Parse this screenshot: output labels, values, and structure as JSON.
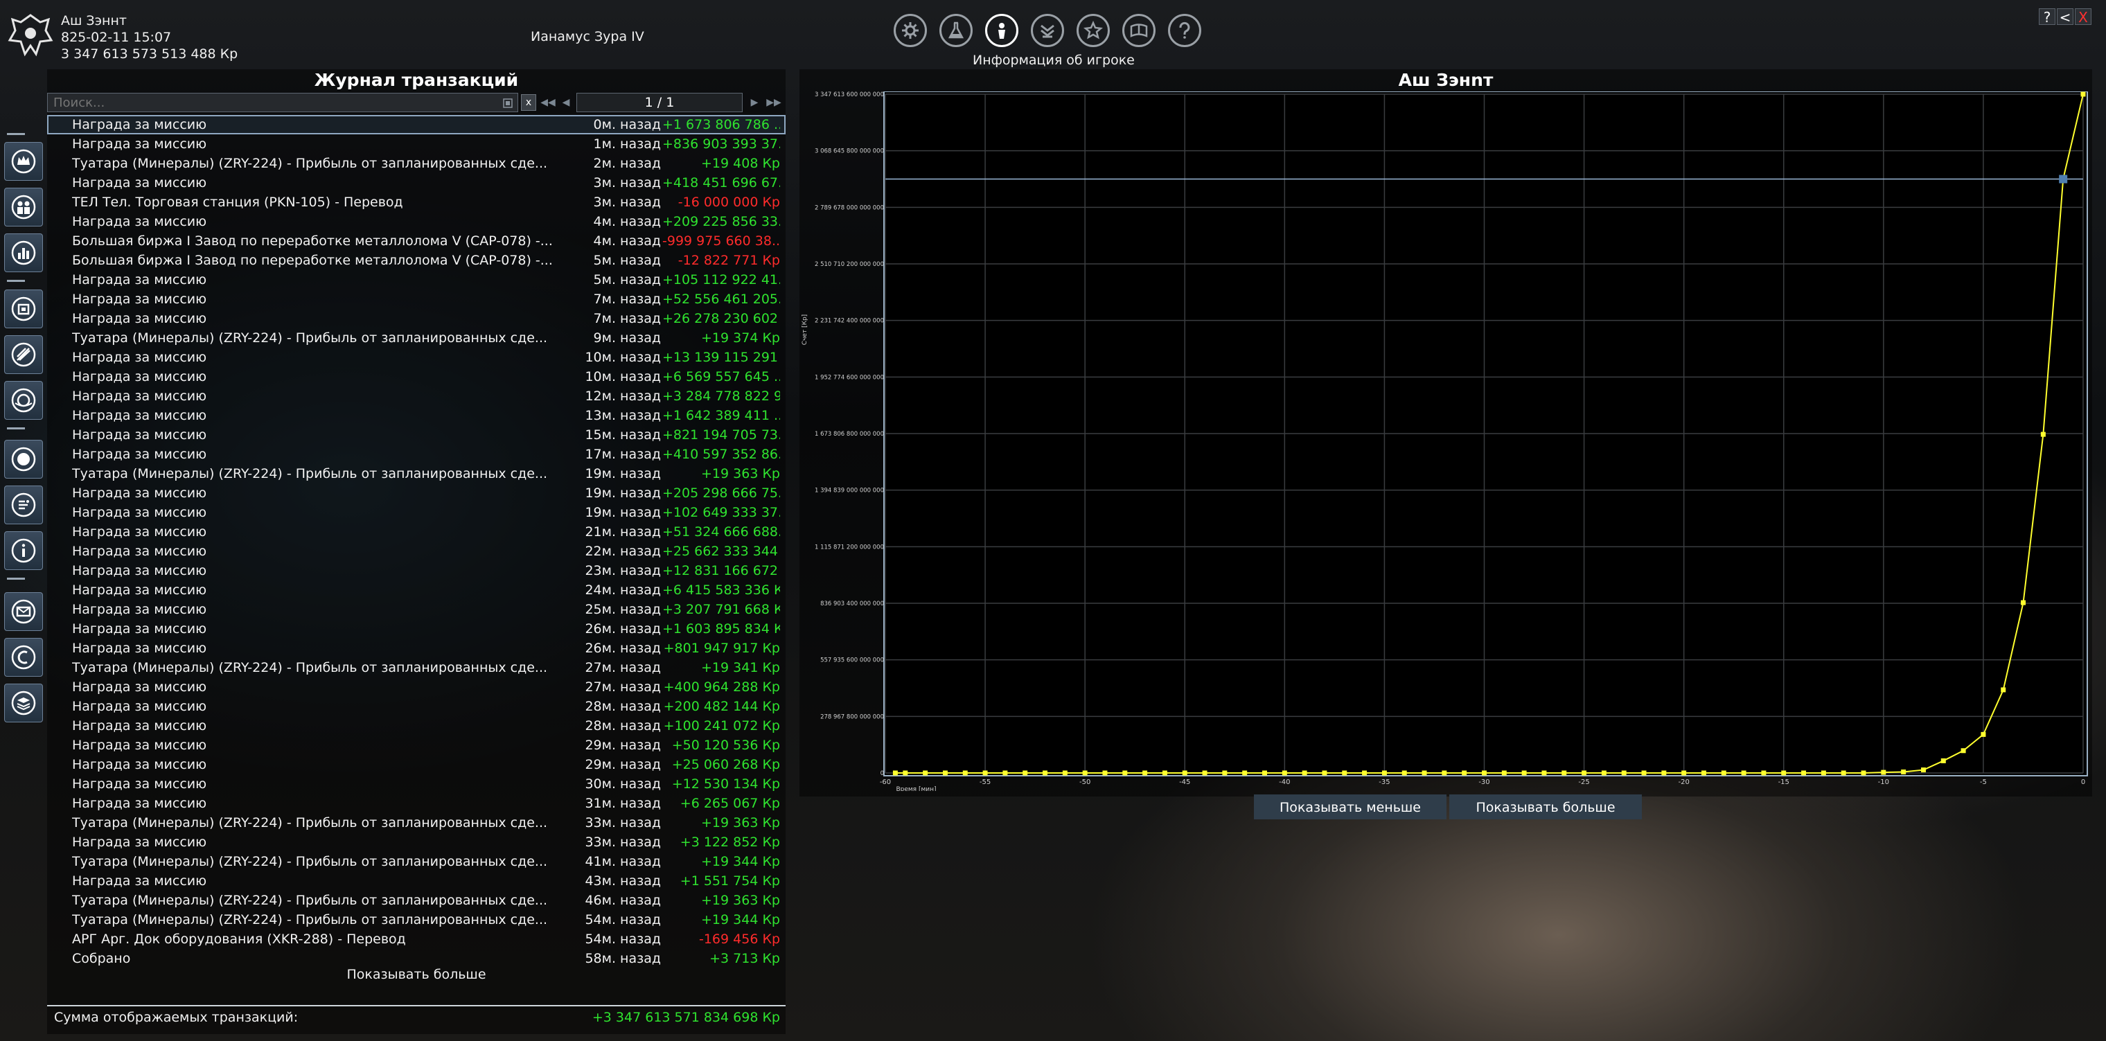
{
  "header": {
    "player_name": "Аш Зэннт",
    "datetime": "825-02-11 15:07",
    "balance": "3 347 613 573 513 488 Кр",
    "sector": "Ианамус Зура IV"
  },
  "menu": {
    "icons": [
      "settings-icon",
      "flask-icon",
      "player-info-icon",
      "ship-icon",
      "empire-icon",
      "encyclopedia-icon",
      "help-icon"
    ],
    "active_label": "Информация об игроке"
  },
  "window_controls": [
    "?",
    "<",
    "X"
  ],
  "rail_icons": [
    "crown-icon",
    "people-icon",
    "bar-chart-icon",
    "station-icon",
    "ship-gear-icon",
    "globe-icon",
    "planet-icon",
    "fleet-icon",
    "info-icon",
    "mail-icon",
    "credits-icon",
    "stack-icon"
  ],
  "transactions": {
    "title": "Журнал транзакций",
    "search_placeholder": "Поиск...",
    "clear": "x",
    "page": "1 / 1",
    "rows": [
      {
        "desc": "Награда за миссию",
        "time": "0м. назад",
        "amount": "+1 673 806 786 ...",
        "sign": "pos"
      },
      {
        "desc": "Награда за миссию",
        "time": "1м. назад",
        "amount": "+836 903 393 37...",
        "sign": "pos"
      },
      {
        "desc": "Туатара (Минералы) (ZRY-224) - Прибыль от запланированных сде...",
        "time": "2м. назад",
        "amount": "+19 408 Кр",
        "sign": "pos"
      },
      {
        "desc": "Награда за миссию",
        "time": "3м. назад",
        "amount": "+418 451 696 67...",
        "sign": "pos"
      },
      {
        "desc": "ТЕЛ Тел. Торговая станция (PKN-105) - Перевод",
        "time": "3м. назад",
        "amount": "-16 000 000 Кр",
        "sign": "neg"
      },
      {
        "desc": "Награда за миссию",
        "time": "4м. назад",
        "amount": "+209 225 856 33...",
        "sign": "pos"
      },
      {
        "desc": "Большая биржа I Завод по переработке металлолома V (CAP-078) -...",
        "time": "4м. назад",
        "amount": "-999 975 660 38...",
        "sign": "neg"
      },
      {
        "desc": "Большая биржа I Завод по переработке металлолома V (CAP-078) -...",
        "time": "5м. назад",
        "amount": "-12 822 771 Кр",
        "sign": "neg"
      },
      {
        "desc": "Награда за миссию",
        "time": "5м. назад",
        "amount": "+105 112 922 41...",
        "sign": "pos"
      },
      {
        "desc": "Награда за миссию",
        "time": "7м. назад",
        "amount": "+52 556 461 205...",
        "sign": "pos"
      },
      {
        "desc": "Награда за миссию",
        "time": "7м. назад",
        "amount": "+26 278 230 602 ...",
        "sign": "pos"
      },
      {
        "desc": "Туатара (Минералы) (ZRY-224) - Прибыль от запланированных сде...",
        "time": "9м. назад",
        "amount": "+19 374 Кр",
        "sign": "pos"
      },
      {
        "desc": "Награда за миссию",
        "time": "10м. назад",
        "amount": "+13 139 115 291 ...",
        "sign": "pos"
      },
      {
        "desc": "Награда за миссию",
        "time": "10м. назад",
        "amount": "+6 569 557 645 ...",
        "sign": "pos"
      },
      {
        "desc": "Награда за миссию",
        "time": "12м. назад",
        "amount": "+3 284 778 822 9...",
        "sign": "pos"
      },
      {
        "desc": "Награда за миссию",
        "time": "13м. назад",
        "amount": "+1 642 389 411 ...",
        "sign": "pos"
      },
      {
        "desc": "Награда за миссию",
        "time": "15м. назад",
        "amount": "+821 194 705 73...",
        "sign": "pos"
      },
      {
        "desc": "Награда за миссию",
        "time": "17м. назад",
        "amount": "+410 597 352 86...",
        "sign": "pos"
      },
      {
        "desc": "Туатара (Минералы) (ZRY-224) - Прибыль от запланированных сде...",
        "time": "19м. назад",
        "amount": "+19 363 Кр",
        "sign": "pos"
      },
      {
        "desc": "Награда за миссию",
        "time": "19м. назад",
        "amount": "+205 298 666 75...",
        "sign": "pos"
      },
      {
        "desc": "Награда за миссию",
        "time": "19м. назад",
        "amount": "+102 649 333 37...",
        "sign": "pos"
      },
      {
        "desc": "Награда за миссию",
        "time": "21м. назад",
        "amount": "+51 324 666 688...",
        "sign": "pos"
      },
      {
        "desc": "Награда за миссию",
        "time": "22м. назад",
        "amount": "+25 662 333 344 ...",
        "sign": "pos"
      },
      {
        "desc": "Награда за миссию",
        "time": "23м. назад",
        "amount": "+12 831 166 672 ...",
        "sign": "pos"
      },
      {
        "desc": "Награда за миссию",
        "time": "24м. назад",
        "amount": "+6 415 583 336 Кр",
        "sign": "pos"
      },
      {
        "desc": "Награда за миссию",
        "time": "25м. назад",
        "amount": "+3 207 791 668 Кр",
        "sign": "pos"
      },
      {
        "desc": "Награда за миссию",
        "time": "26м. назад",
        "amount": "+1 603 895 834 Кр",
        "sign": "pos"
      },
      {
        "desc": "Награда за миссию",
        "time": "26м. назад",
        "amount": "+801 947 917 Кр",
        "sign": "pos"
      },
      {
        "desc": "Туатара (Минералы) (ZRY-224) - Прибыль от запланированных сде...",
        "time": "27м. назад",
        "amount": "+19 341 Кр",
        "sign": "pos"
      },
      {
        "desc": "Награда за миссию",
        "time": "27м. назад",
        "amount": "+400 964 288 Кр",
        "sign": "pos"
      },
      {
        "desc": "Награда за миссию",
        "time": "28м. назад",
        "amount": "+200 482 144 Кр",
        "sign": "pos"
      },
      {
        "desc": "Награда за миссию",
        "time": "28м. назад",
        "amount": "+100 241 072 Кр",
        "sign": "pos"
      },
      {
        "desc": "Награда за миссию",
        "time": "29м. назад",
        "amount": "+50 120 536 Кр",
        "sign": "pos"
      },
      {
        "desc": "Награда за миссию",
        "time": "29м. назад",
        "amount": "+25 060 268 Кр",
        "sign": "pos"
      },
      {
        "desc": "Награда за миссию",
        "time": "30м. назад",
        "amount": "+12 530 134 Кр",
        "sign": "pos"
      },
      {
        "desc": "Награда за миссию",
        "time": "31м. назад",
        "amount": "+6 265 067 Кр",
        "sign": "pos"
      },
      {
        "desc": "Туатара (Минералы) (ZRY-224) - Прибыль от запланированных сде...",
        "time": "33м. назад",
        "amount": "+19 363 Кр",
        "sign": "pos"
      },
      {
        "desc": "Награда за миссию",
        "time": "33м. назад",
        "amount": "+3 122 852 Кр",
        "sign": "pos"
      },
      {
        "desc": "Туатара (Минералы) (ZRY-224) - Прибыль от запланированных сде...",
        "time": "41м. назад",
        "amount": "+19 344 Кр",
        "sign": "pos"
      },
      {
        "desc": "Награда за миссию",
        "time": "43м. назад",
        "amount": "+1 551 754 Кр",
        "sign": "pos"
      },
      {
        "desc": "Туатара (Минералы) (ZRY-224) - Прибыль от запланированных сде...",
        "time": "46м. назад",
        "amount": "+19 363 Кр",
        "sign": "pos"
      },
      {
        "desc": "Туатара (Минералы) (ZRY-224) - Прибыль от запланированных сде...",
        "time": "54м. назад",
        "amount": "+19 344 Кр",
        "sign": "pos"
      },
      {
        "desc": "АРГ Арг. Док оборудования (XKR-288) - Перевод",
        "time": "54м. назад",
        "amount": "-169 456 Кр",
        "sign": "neg"
      },
      {
        "desc": "Собрано",
        "time": "58м. назад",
        "amount": "+3 713 Кр",
        "sign": "pos"
      }
    ],
    "show_more": "Показывать больше",
    "sum_label": "Сумма отображаемых транзакций:",
    "sum_value": "+3 347 613 571 834 698 Кр"
  },
  "chart_panel": {
    "show_less": "Показывать меньше",
    "show_more": "Показывать больше"
  },
  "chart_data": {
    "type": "line",
    "title": "Аш Зэнnт",
    "xlabel": "Время [мин]",
    "ylabel": "Счет [Кр]",
    "xlim": [
      -60,
      0
    ],
    "ylim": [
      0,
      3347613600000000
    ],
    "x_ticks": [
      "-60",
      "-55",
      "-50",
      "-45",
      "-40",
      "-35",
      "-30",
      "-25",
      "-20",
      "-15",
      "-10",
      "-5",
      "0"
    ],
    "y_ticks": [
      "0",
      "278 967 800 000 000",
      "557 935 600 000 000",
      "836 903 400 000 000",
      "1 115 871 200 000 000",
      "1 394 839 000 000 000",
      "1 673 806 800 000 000",
      "1 952 774 600 000 000",
      "2 231 742 400 000 000",
      "2 510 710 200 000 000",
      "2 789 678 000 000 000",
      "3 068 645 800 000 000",
      "3 347 613 600 000 000"
    ],
    "grid": true,
    "line_color": "#ffff2e",
    "marker_value": 2929000000000000,
    "series": [
      {
        "x": [
          -59.5,
          -59,
          -58,
          -57,
          -56,
          -55,
          -54,
          -53,
          -52,
          -51,
          -50,
          -49,
          -48,
          -47,
          -46,
          -45,
          -44,
          -43,
          -42,
          -41,
          -40,
          -39,
          -38,
          -37,
          -36,
          -35,
          -34,
          -33,
          -32,
          -31,
          -30,
          -29,
          -28,
          -27,
          -26,
          -25,
          -24,
          -23,
          -22,
          -21,
          -20,
          -19,
          -18,
          -17,
          -16,
          -15,
          -14,
          -13,
          -12,
          -11,
          -10,
          -9,
          -8,
          -7,
          -6,
          -5,
          -4,
          -3,
          -2,
          -1,
          0
        ],
        "y": [
          0,
          0,
          0,
          0,
          0,
          0,
          0,
          0,
          0,
          0,
          0,
          0,
          0,
          0,
          0,
          0,
          0,
          0,
          0,
          0,
          0,
          0,
          0,
          0,
          0,
          0,
          0,
          0,
          0,
          0,
          0,
          0,
          0,
          0,
          0,
          0,
          0,
          0,
          0,
          0,
          0,
          0,
          0,
          0,
          0,
          0,
          0,
          0,
          0,
          0,
          3000000000000,
          5000000000000,
          15000000000000,
          60000000000000,
          110000000000000,
          190000000000000,
          410000000000000,
          840000000000000,
          1670000000000000,
          2930000000000000,
          3347613571834698
        ]
      }
    ]
  }
}
